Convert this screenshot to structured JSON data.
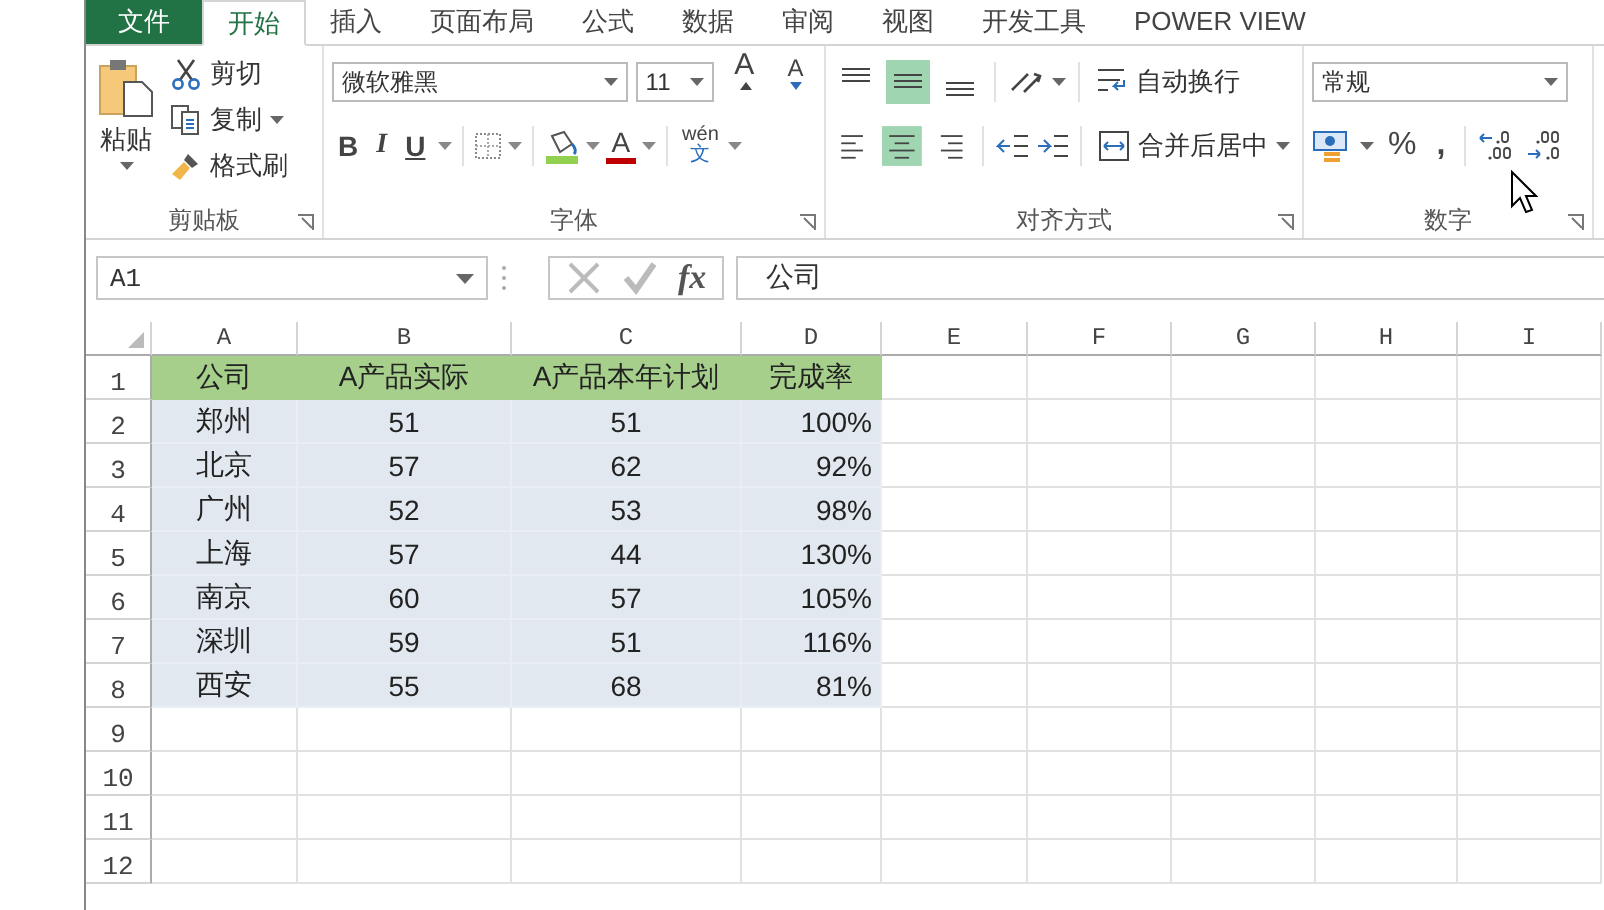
{
  "tabs": [
    {
      "label": "文件",
      "kind": "file",
      "selected": false
    },
    {
      "label": "开始",
      "kind": "tab",
      "selected": true
    },
    {
      "label": "插入",
      "kind": "tab",
      "selected": false
    },
    {
      "label": "页面布局",
      "kind": "tab",
      "selected": false
    },
    {
      "label": "公式",
      "kind": "tab",
      "selected": false
    },
    {
      "label": "数据",
      "kind": "tab",
      "selected": false
    },
    {
      "label": "审阅",
      "kind": "tab",
      "selected": false
    },
    {
      "label": "视图",
      "kind": "tab",
      "selected": false
    },
    {
      "label": "开发工具",
      "kind": "tab",
      "selected": false
    },
    {
      "label": "POWER VIEW",
      "kind": "tab",
      "selected": false
    }
  ],
  "clipboard": {
    "paste": "粘贴",
    "cut": "剪切",
    "copy": "复制",
    "format_painter": "格式刷",
    "label": "剪贴板"
  },
  "font": {
    "name": "微软雅黑",
    "size": "11",
    "grow": "A",
    "shrink": "A",
    "bold": "B",
    "italic": "I",
    "underline": "U",
    "font_color": "A",
    "phonetic_top": "wén",
    "phonetic_bottom": "文",
    "label": "字体"
  },
  "alignment": {
    "vertical": [
      {
        "kind": "top",
        "selected": false
      },
      {
        "kind": "middle",
        "selected": true
      },
      {
        "kind": "bottom",
        "selected": false
      }
    ],
    "horizontal": [
      {
        "kind": "left",
        "selected": false
      },
      {
        "kind": "center",
        "selected": true
      },
      {
        "kind": "right",
        "selected": false
      }
    ],
    "wrap": "自动换行",
    "merge": "合并后居中",
    "label": "对齐方式"
  },
  "number": {
    "format": "常规",
    "percent": "%",
    "comma": ",",
    "label": "数字"
  },
  "formula_bar": {
    "name_box": "A1",
    "fx": "fx",
    "content": "公司"
  },
  "sheet": {
    "columns": [
      "A",
      "B",
      "C",
      "D",
      "E",
      "F",
      "G",
      "H",
      "I"
    ],
    "row_numbers": [
      "1",
      "2",
      "3",
      "4",
      "5",
      "6",
      "7",
      "8",
      "9",
      "10",
      "11",
      "12"
    ],
    "header": [
      "公司",
      "A产品实际",
      "A产品本年计划",
      "完成率"
    ],
    "rows": [
      [
        "郑州",
        "51",
        "51",
        "100%"
      ],
      [
        "北京",
        "57",
        "62",
        "92%"
      ],
      [
        "广州",
        "52",
        "53",
        "98%"
      ],
      [
        "上海",
        "57",
        "44",
        "130%"
      ],
      [
        "南京",
        "60",
        "57",
        "105%"
      ],
      [
        "深圳",
        "59",
        "51",
        "116%"
      ],
      [
        "西安",
        "55",
        "68",
        "81%"
      ]
    ]
  }
}
